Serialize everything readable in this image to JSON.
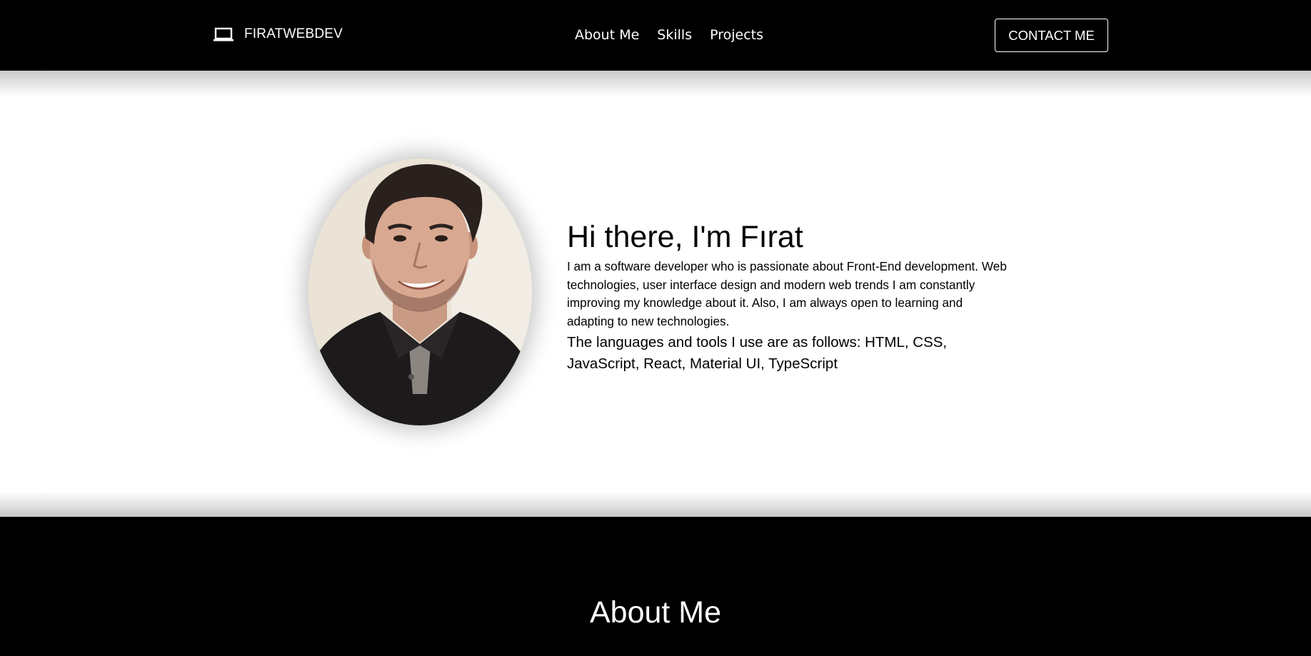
{
  "header": {
    "brand_icon": "laptop-icon",
    "brand_name": "FIRATWEBDEV",
    "nav": [
      "About Me",
      "Skills",
      "Projects"
    ],
    "contact_label": "CONTACT ME"
  },
  "hero": {
    "photo": "profile-photo",
    "title": "Hi there, I'm Fırat",
    "description": "I am a software developer who is passionate about Front-End development. Web technologies, user interface design and modern web trends I am constantly improving my knowledge about it. Also, I am always open to learning and adapting to new technologies.",
    "tools": "The languages and tools I use are as follows: HTML, CSS, JavaScript, React, Material UI, TypeScript"
  },
  "about": {
    "title": "About Me"
  },
  "colors": {
    "header_bg": "#000000",
    "hero_bg": "#ffffff",
    "text_dark": "#000000",
    "text_light": "#ffffff"
  }
}
